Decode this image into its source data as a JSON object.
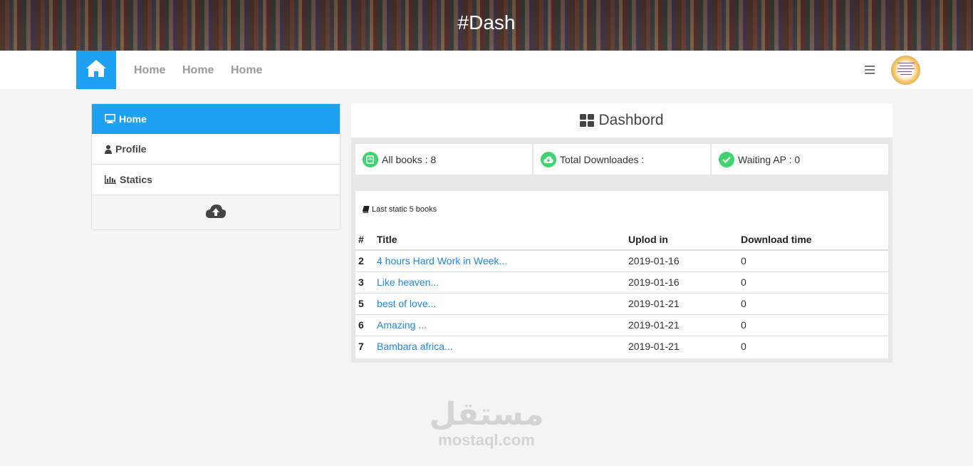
{
  "banner": {
    "title": "#Dash"
  },
  "nav": {
    "links": [
      "Home",
      "Home",
      "Home"
    ]
  },
  "sidebar": {
    "items": [
      {
        "label": "Home",
        "icon": "monitor-icon"
      },
      {
        "label": "Profile",
        "icon": "user-icon"
      },
      {
        "label": "Statics",
        "icon": "bar-chart-icon"
      }
    ],
    "upload_icon": "cloud-upload-icon"
  },
  "main": {
    "title": "Dashbord",
    "stats": [
      {
        "label": "All books : 8",
        "icon": "book-icon"
      },
      {
        "label": "Total Downloades :",
        "icon": "cloud-download-icon"
      },
      {
        "label": "Waiting AP : 0",
        "icon": "check-icon"
      }
    ],
    "table": {
      "caption": "Last static 5 books",
      "headers": [
        "#",
        "Title",
        "Uplod in",
        "Download time"
      ],
      "rows": [
        [
          "2",
          "4 hours Hard Work in Week...",
          "2019-01-16",
          "0"
        ],
        [
          "3",
          "Like heaven...",
          "2019-01-16",
          "0"
        ],
        [
          "5",
          "best of love...",
          "2019-01-21",
          "0"
        ],
        [
          "6",
          "Amazing ...",
          "2019-01-21",
          "0"
        ],
        [
          "7",
          "Bambara africa...",
          "2019-01-21",
          "0"
        ]
      ]
    }
  },
  "watermark": {
    "arabic": "مستقل",
    "latin": "mostaql.com"
  },
  "colors": {
    "accent": "#1ea1f2",
    "success": "#3fd46f",
    "link": "#1e88e5"
  }
}
